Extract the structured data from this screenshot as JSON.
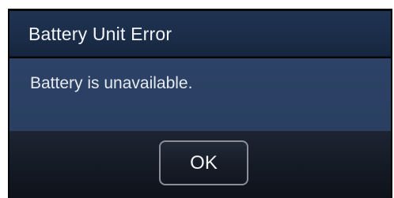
{
  "dialog": {
    "title": "Battery Unit Error",
    "message": "Battery is unavailable.",
    "ok_label": "OK"
  },
  "colors": {
    "title_bar": "#1f3453",
    "message_area": "#2c4266",
    "button_area": "#141a24",
    "button_border": "#8a8f99",
    "text": "#f2f4f7"
  }
}
